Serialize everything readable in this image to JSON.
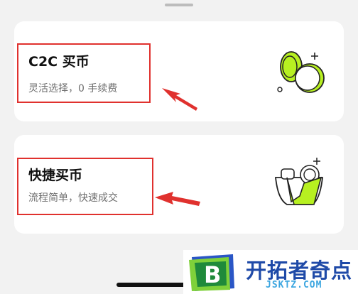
{
  "options": [
    {
      "title": "C2C 买币",
      "subtitle": "灵活选择，0 手续费"
    },
    {
      "title": "快捷买币",
      "subtitle": "流程简单，快速成交"
    }
  ],
  "watermark": {
    "name": "开拓者奇点",
    "domain": "JSKTZ.COM",
    "logo_letter": "B"
  },
  "colors": {
    "accent": "#b7f021",
    "annotation": "#e0312e",
    "brand": "#1f4aa8"
  },
  "icons": [
    "c2c-coins-icon",
    "quick-buy-bag-icon",
    "annotation-arrow-icon"
  ]
}
